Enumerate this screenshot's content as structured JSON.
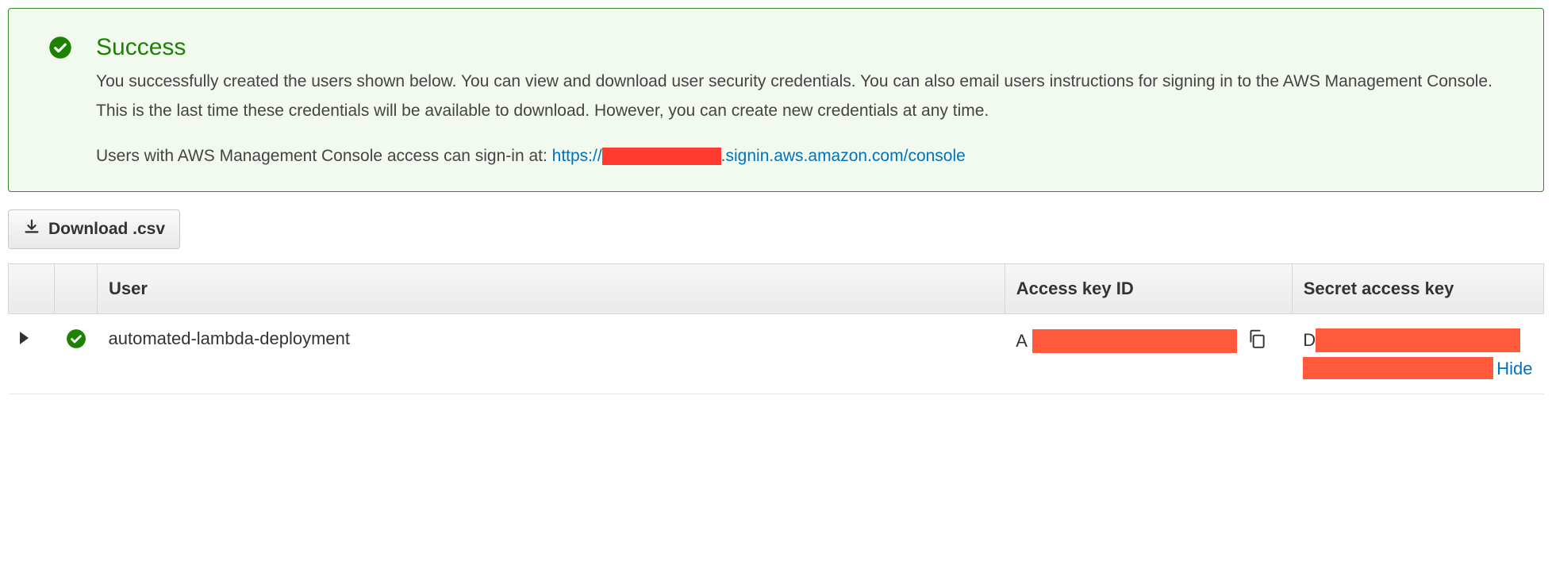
{
  "alert": {
    "title": "Success",
    "description": "You successfully created the users shown below. You can view and download user security credentials. You can also email users instructions for signing in to the AWS Management Console. This is the last time these credentials will be available to download. However, you can create new credentials at any time.",
    "signin_prefix": "Users with AWS Management Console access can sign-in at: ",
    "signin_url_prefix": "https://",
    "signin_url_suffix": ".signin.aws.amazon.com/console"
  },
  "buttons": {
    "download_csv": "Download .csv"
  },
  "table": {
    "headers": {
      "user": "User",
      "access_key_id": "Access key ID",
      "secret_access_key": "Secret access key"
    },
    "rows": [
      {
        "username": "automated-lambda-deployment",
        "access_key_prefix": "A",
        "secret_key_prefix": "D",
        "hide_label": "Hide"
      }
    ]
  }
}
